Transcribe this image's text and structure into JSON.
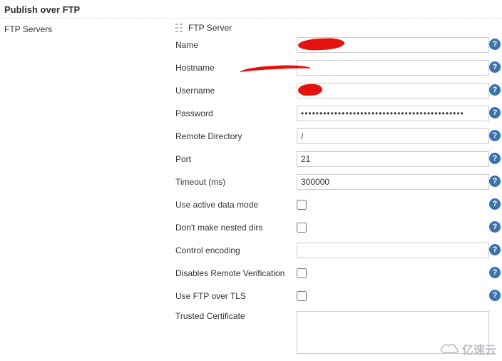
{
  "section": {
    "title": "Publish over FTP"
  },
  "leftColumn": {
    "label": "FTP Servers"
  },
  "subsection": {
    "label": "FTP Server"
  },
  "fields": {
    "name": {
      "label": "Name",
      "value": ""
    },
    "hostname": {
      "label": "Hostname",
      "value": ""
    },
    "username": {
      "label": "Username",
      "value": ""
    },
    "password": {
      "label": "Password",
      "value": "••••••••••••••••••••••••••••••••••••••••••••"
    },
    "remoteDir": {
      "label": "Remote Directory",
      "value": "/"
    },
    "port": {
      "label": "Port",
      "value": "21"
    },
    "timeout": {
      "label": "Timeout (ms)",
      "value": "300000"
    },
    "activeMode": {
      "label": "Use active data mode"
    },
    "noNested": {
      "label": "Don't make nested dirs"
    },
    "encoding": {
      "label": "Control encoding",
      "value": ""
    },
    "disableVerif": {
      "label": "Disables Remote Verification"
    },
    "useTls": {
      "label": "Use FTP over TLS"
    },
    "trustedCert": {
      "label": "Trusted Certificate",
      "value": ""
    }
  },
  "helpGlyph": "?",
  "watermark": "亿速云"
}
